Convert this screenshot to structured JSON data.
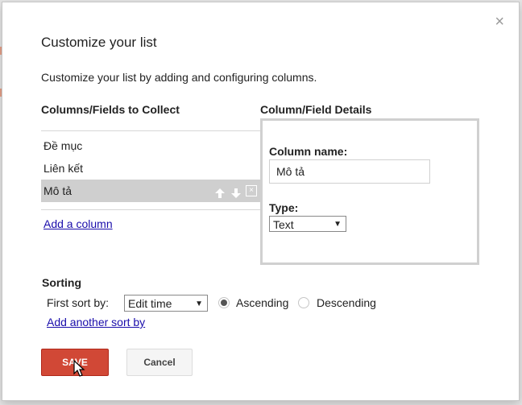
{
  "dialog": {
    "close_glyph": "×",
    "title": "Customize your list",
    "description": "Customize your list by adding and configuring columns."
  },
  "columns_panel": {
    "heading": "Columns/Fields to Collect",
    "items": [
      {
        "label": "Đề mục"
      },
      {
        "label": "Liên kết"
      },
      {
        "label": "Mô tả",
        "selected": true
      }
    ],
    "remove_glyph": "×",
    "add_column_link": "Add a column"
  },
  "details_panel": {
    "heading": "Column/Field Details",
    "column_name_label": "Column name:",
    "column_name_value": "Mô tả",
    "type_label": "Type:",
    "type_value": "Text",
    "caret": "▼"
  },
  "sorting": {
    "heading": "Sorting",
    "first_sort_label": "First sort by:",
    "sort_value": "Edit time",
    "caret": "▼",
    "ascending_label": "Ascending",
    "descending_label": "Descending",
    "order_selected": "ascending",
    "add_sort_link": "Add another sort by"
  },
  "buttons": {
    "save": "SAVE",
    "cancel": "Cancel"
  },
  "colors": {
    "save_button": "#d14836",
    "link": "#1a0dab",
    "selected_row": "#cfcfcf"
  }
}
